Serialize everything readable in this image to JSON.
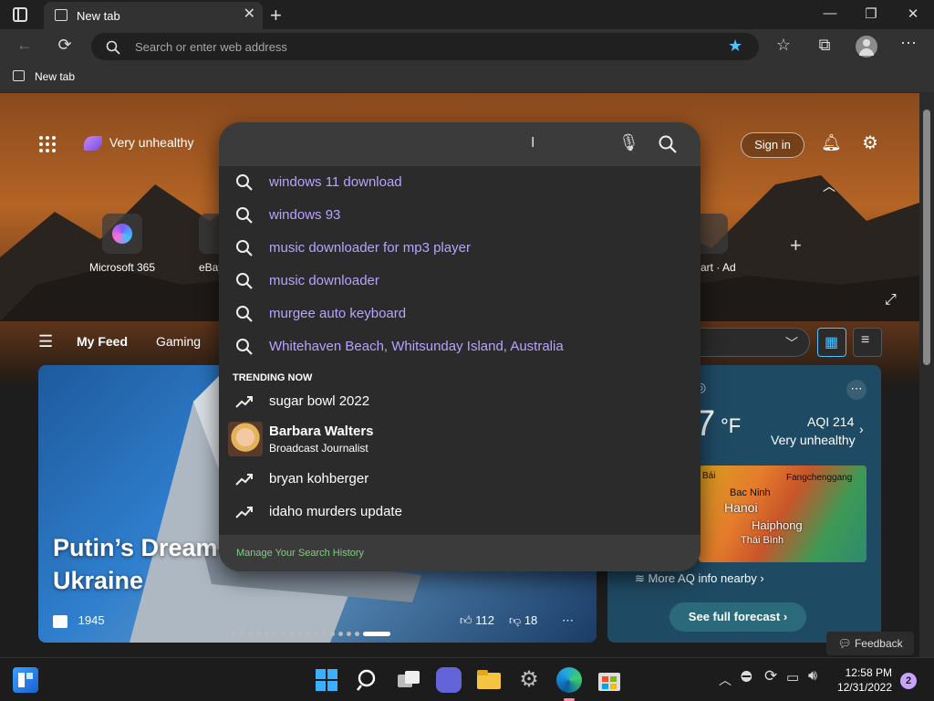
{
  "browser": {
    "tab_title": "New tab",
    "address_placeholder": "Search or enter web address",
    "favorites_bar_item": "New tab"
  },
  "newtab": {
    "weather_chip": "Very unhealthy",
    "sign_in": "Sign in",
    "quick_links": [
      {
        "label": "Microsoft 365"
      },
      {
        "label": "eBay"
      },
      {
        "label": "art · Ad"
      }
    ],
    "feed_tabs": [
      "My Feed",
      "Gaming"
    ],
    "hero": {
      "title": "Putin’s Dream Comes to the Rescue in Ukraine",
      "source": "1945",
      "likes": "112",
      "dislikes": "18"
    },
    "weather_card": {
      "temp_suffix": "°F",
      "temp_value": "7",
      "aqi": "AQI 214",
      "aqi_status": "Very unhealthy",
      "map_labels": [
        "Bái",
        "Fangchenggang",
        "Bac Ninh",
        "Hanoi",
        "Haiphong",
        "Thái Bình"
      ],
      "more_aq": "More AQ info nearby",
      "see_forecast": "See full forecast"
    },
    "feedback": "Feedback"
  },
  "search_dropdown": {
    "suggestions": [
      "windows 11 download",
      "windows 93",
      "music downloader for mp3 player",
      "music downloader",
      "murgee auto keyboard",
      "Whitehaven Beach, Whitsunday Island, Australia"
    ],
    "trending_heading": "TRENDING NOW",
    "trending": [
      {
        "title": "sugar bowl 2022"
      },
      {
        "title": "Barbara Walters",
        "subtitle": "Broadcast Journalist"
      },
      {
        "title": "bryan kohberger"
      },
      {
        "title": "idaho murders update"
      }
    ],
    "footer": "Manage Your Search History"
  },
  "taskbar": {
    "time": "12:58 PM",
    "date": "12/31/2022",
    "notifications": "2"
  },
  "colors": {
    "suggestion_text": "#b8a3ff",
    "accent_blue": "#4cc2ff",
    "footer_link": "#7fd07f"
  }
}
